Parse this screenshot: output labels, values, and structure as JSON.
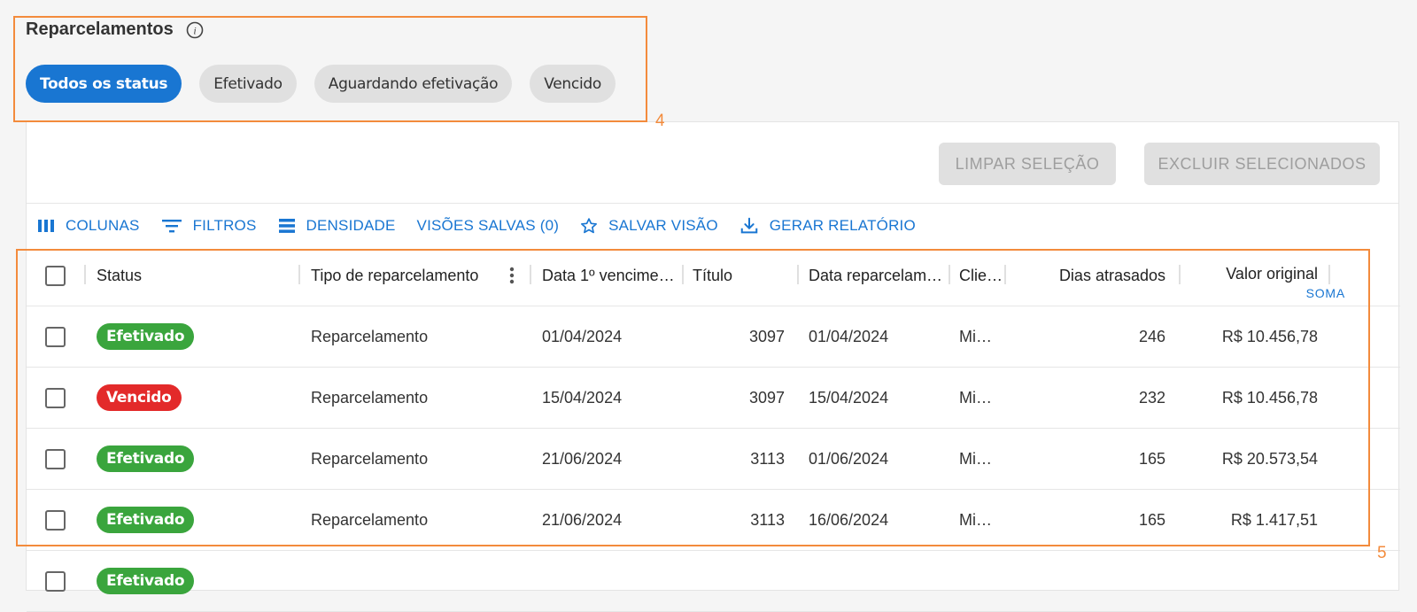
{
  "page": {
    "title": "Reparcelamentos"
  },
  "status_filters": [
    {
      "label": "Todos os status",
      "active": true
    },
    {
      "label": "Efetivado",
      "active": false
    },
    {
      "label": "Aguardando efetivação",
      "active": false
    },
    {
      "label": "Vencido",
      "active": false
    }
  ],
  "actions": {
    "clear_selection": "LIMPAR SELEÇÃO",
    "delete_selected": "EXCLUIR SELECIONADOS"
  },
  "toolbar": {
    "columns": "COLUNAS",
    "filters": "FILTROS",
    "density": "DENSIDADE",
    "saved_views": "VISÕES SALVAS (0)",
    "save_view": "SALVAR VISÃO",
    "generate_report": "GERAR RELATÓRIO"
  },
  "table": {
    "headers": {
      "status": "Status",
      "tipo": "Tipo de reparcelamento",
      "data_venc": "Data 1º vencime…",
      "titulo": "Título",
      "data_repar": "Data reparcelam…",
      "cliente": "Clie…",
      "dias": "Dias atrasados",
      "valor": "Valor original",
      "valor_agg": "SOMA"
    },
    "rows": [
      {
        "status": "Efetivado",
        "tipo": "Reparcelamento",
        "data_venc": "01/04/2024",
        "titulo": "3097",
        "data_repar": "01/04/2024",
        "cliente": "Mi…",
        "dias": "246",
        "valor": "R$ 10.456,78"
      },
      {
        "status": "Vencido",
        "tipo": "Reparcelamento",
        "data_venc": "15/04/2024",
        "titulo": "3097",
        "data_repar": "15/04/2024",
        "cliente": "Mi…",
        "dias": "232",
        "valor": "R$ 10.456,78"
      },
      {
        "status": "Efetivado",
        "tipo": "Reparcelamento",
        "data_venc": "21/06/2024",
        "titulo": "3113",
        "data_repar": "01/06/2024",
        "cliente": "Mi…",
        "dias": "165",
        "valor": "R$ 20.573,54"
      },
      {
        "status": "Efetivado",
        "tipo": "Reparcelamento",
        "data_venc": "21/06/2024",
        "titulo": "3113",
        "data_repar": "16/06/2024",
        "cliente": "Mi…",
        "dias": "165",
        "valor": "R$ 1.417,51"
      },
      {
        "status": "Efetivado",
        "tipo": "",
        "data_venc": "",
        "titulo": "",
        "data_repar": "",
        "cliente": "",
        "dias": "",
        "valor": ""
      }
    ]
  },
  "status_colors": {
    "Efetivado": "#3aa53d",
    "Vencido": "#e32a2a"
  },
  "annotations": [
    "4",
    "5"
  ]
}
